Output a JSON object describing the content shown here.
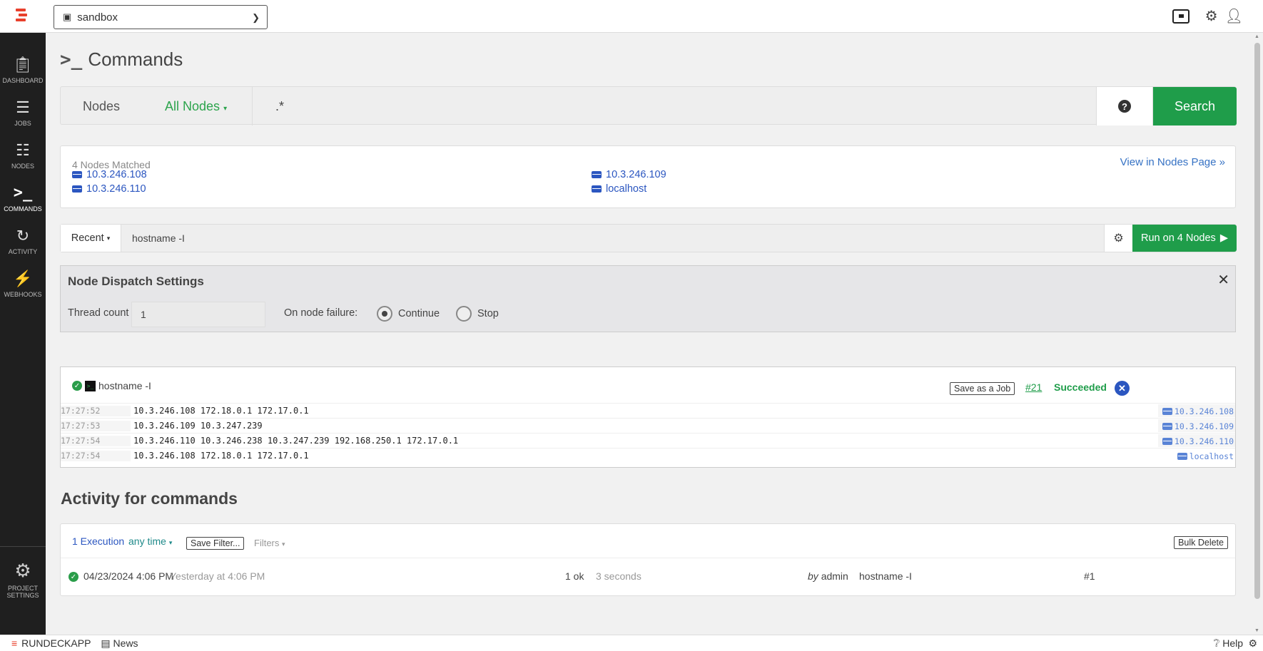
{
  "project": {
    "name": "sandbox"
  },
  "sidebar": {
    "items": [
      {
        "label": "DASHBOARD"
      },
      {
        "label": "JOBS"
      },
      {
        "label": "NODES"
      },
      {
        "label": "COMMANDS"
      },
      {
        "label": "ACTIVITY"
      },
      {
        "label": "WEBHOOKS"
      }
    ],
    "settings": {
      "line1": "PROJECT",
      "line2": "SETTINGS"
    }
  },
  "page": {
    "title": "Commands"
  },
  "node_filter": {
    "nodes_label": "Nodes",
    "filter_dropdown": "All Nodes",
    "query": ".*",
    "help_symbol": "?",
    "search_label": "Search"
  },
  "matched": {
    "count_label": "4 Nodes Matched",
    "view_link": "View in Nodes Page »",
    "nodes": [
      "10.3.246.108",
      "10.3.246.109",
      "10.3.246.110",
      "localhost"
    ]
  },
  "command": {
    "recent_label": "Recent",
    "value": "hostname -I",
    "run_label": "Run on 4 Nodes"
  },
  "dispatch": {
    "title": "Node Dispatch Settings",
    "thread_label": "Thread count",
    "thread_value": "1",
    "failure_label": "On node failure:",
    "opt_continue": "Continue",
    "opt_stop": "Stop",
    "selected": "Continue"
  },
  "output": {
    "command": "hostname -I",
    "save_job": "Save as a Job",
    "exec_number": "#21",
    "status": "Succeeded",
    "rows": [
      {
        "time": "17:27:52",
        "text": "10.3.246.108 172.18.0.1 172.17.0.1",
        "node": "10.3.246.108"
      },
      {
        "time": "17:27:53",
        "text": "10.3.246.109 10.3.247.239",
        "node": "10.3.246.109"
      },
      {
        "time": "17:27:54",
        "text": "10.3.246.110 10.3.246.238 10.3.247.239 192.168.250.1 172.17.0.1",
        "node": "10.3.246.110"
      },
      {
        "time": "17:27:54",
        "text": "10.3.246.108 172.18.0.1 172.17.0.1",
        "node": "localhost"
      }
    ]
  },
  "activity": {
    "title": "Activity for commands",
    "executions": "1 Execution",
    "time_filter": "any time",
    "save_filter": "Save Filter...",
    "filters": "Filters",
    "bulk_delete": "Bulk Delete",
    "row": {
      "date": "04/23/2024 4:06 PM",
      "relative": "Yesterday at 4:06 PM",
      "ok": "1 ok",
      "duration": "3 seconds",
      "by": "by",
      "user": "admin",
      "command": "hostname -I",
      "id": "#1"
    }
  },
  "footer": {
    "brand": "RUNDECKAPP",
    "news": "News",
    "help": "Help"
  },
  "colors": {
    "accent": "#1f9d4a",
    "link": "#2b56c0",
    "sidebar": "#1f1f1f",
    "logo": "#e8402c"
  }
}
